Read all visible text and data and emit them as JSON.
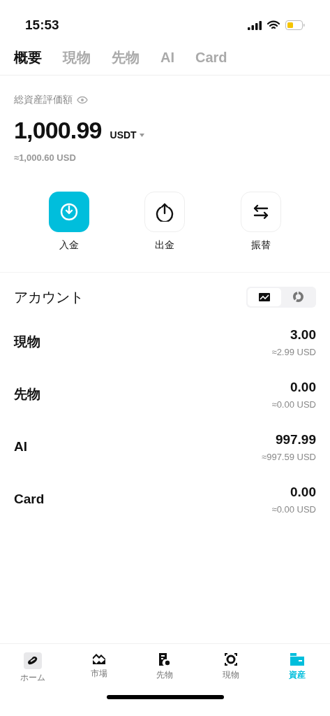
{
  "status_bar": {
    "time": "15:53"
  },
  "tabs": [
    {
      "label": "概要",
      "selected": true
    },
    {
      "label": "現物",
      "selected": false
    },
    {
      "label": "先物",
      "selected": false
    },
    {
      "label": "AI",
      "selected": false
    },
    {
      "label": "Card",
      "selected": false
    }
  ],
  "balance": {
    "label": "総資産評価額",
    "amount": "1,000.99",
    "currency": "USDT",
    "approx": "≈1,000.60 USD"
  },
  "actions": [
    {
      "kind": "deposit",
      "label": "入金",
      "highlighted": true
    },
    {
      "kind": "withdraw",
      "label": "出金",
      "highlighted": false
    },
    {
      "kind": "transfer",
      "label": "振替",
      "highlighted": false
    }
  ],
  "accounts": {
    "title": "アカウント",
    "view_toggle": [
      {
        "kind": "line",
        "selected": true
      },
      {
        "kind": "pie",
        "selected": false
      }
    ],
    "rows": [
      {
        "name": "現物",
        "amount": "3.00",
        "approx": "≈2.99 USD"
      },
      {
        "name": "先物",
        "amount": "0.00",
        "approx": "≈0.00 USD"
      },
      {
        "name": "AI",
        "amount": "997.99",
        "approx": "≈997.59 USD"
      },
      {
        "name": "Card",
        "amount": "0.00",
        "approx": "≈0.00 USD"
      }
    ]
  },
  "bottom_nav": [
    {
      "kind": "home",
      "label": "ホーム",
      "selected": false
    },
    {
      "kind": "market",
      "label": "市場",
      "selected": false
    },
    {
      "kind": "futures",
      "label": "先物",
      "selected": false
    },
    {
      "kind": "spot",
      "label": "現物",
      "selected": false
    },
    {
      "kind": "assets",
      "label": "資産",
      "selected": true
    }
  ]
}
